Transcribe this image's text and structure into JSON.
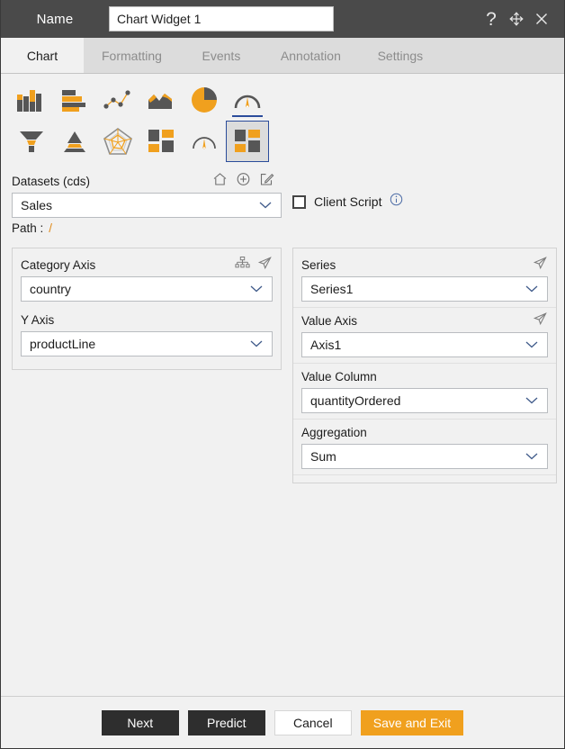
{
  "titlebar": {
    "name_label": "Name",
    "name_value": "Chart Widget 1",
    "name_placeholder": "Name",
    "help_glyph": "?",
    "help_icon": "question-mark-icon",
    "move_icon": "move-arrows-icon",
    "close_icon": "close-icon"
  },
  "tabs": [
    {
      "label": "Chart",
      "active": true
    },
    {
      "label": "Formatting",
      "active": false
    },
    {
      "label": "Events",
      "active": false
    },
    {
      "label": "Annotation",
      "active": false
    },
    {
      "label": "Settings",
      "active": false
    }
  ],
  "chart_types": {
    "row1": [
      {
        "name": "column-chart-icon",
        "state": "normal"
      },
      {
        "name": "bar-chart-icon",
        "state": "normal"
      },
      {
        "name": "scatter-chart-icon",
        "state": "normal"
      },
      {
        "name": "area-chart-icon",
        "state": "normal"
      },
      {
        "name": "pie-chart-icon",
        "state": "normal"
      },
      {
        "name": "gauge-chart-icon",
        "state": "underlined"
      }
    ],
    "row2": [
      {
        "name": "funnel-chart-icon",
        "state": "normal"
      },
      {
        "name": "pyramid-chart-icon",
        "state": "normal"
      },
      {
        "name": "radar-chart-icon",
        "state": "normal"
      },
      {
        "name": "treemap-chart-icon",
        "state": "normal"
      },
      {
        "name": "dial-gauge-chart-icon",
        "state": "normal"
      },
      {
        "name": "tile-chart-icon",
        "state": "selected"
      }
    ],
    "selected_border_color": "#2b4c9b",
    "accent_color": "#f0a01e",
    "dark_color": "#565656"
  },
  "datasets": {
    "title": "Datasets (cds)",
    "home_icon": "home-icon",
    "add_icon": "plus-circle-icon",
    "edit_icon": "edit-pencil-icon",
    "value": "Sales",
    "chevron_icon": "chevron-down-icon",
    "path_label": "Path :",
    "path_value": "/"
  },
  "client_script": {
    "label": "Client Script",
    "checked": false,
    "info_icon": "info-icon",
    "checkbox_icon": "checkbox-unchecked-icon"
  },
  "left_panel": {
    "fields": [
      {
        "label": "Category Axis",
        "value": "country",
        "icons": [
          "hierarchy-icon",
          "navigate-arrow-icon"
        ]
      },
      {
        "label": "Y Axis",
        "value": "productLine",
        "icons": []
      }
    ]
  },
  "right_panel": {
    "fields": [
      {
        "label": "Series",
        "value": "Series1",
        "icons": [
          "navigate-arrow-icon"
        ]
      },
      {
        "label": "Value Axis",
        "value": "Axis1",
        "icons": [
          "navigate-arrow-icon"
        ]
      },
      {
        "label": "Value Column",
        "value": "quantityOrdered",
        "icons": []
      },
      {
        "label": "Aggregation",
        "value": "Sum",
        "icons": []
      }
    ]
  },
  "footer": {
    "next": "Next",
    "predict": "Predict",
    "cancel": "Cancel",
    "save_and_exit": "Save and Exit",
    "accent_color": "#f0a01e",
    "dark_color": "#2e2e2e"
  }
}
